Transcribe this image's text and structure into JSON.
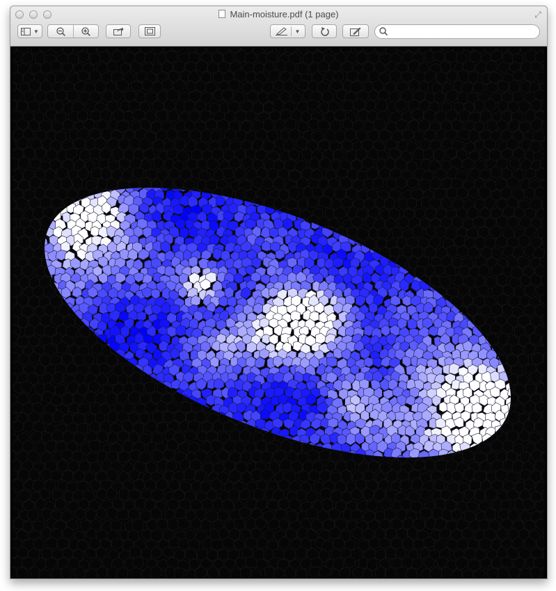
{
  "window": {
    "title": "Main-moisture.pdf (1 page)"
  },
  "toolbar": {
    "sidebar_icon": "sidebar-view-icon",
    "zoom_out_icon": "zoom-out-icon",
    "zoom_in_icon": "zoom-in-icon",
    "share_icon": "share-icon",
    "fit_icon": "fit-to-window-icon",
    "annotate_icon": "annotate-pen-icon",
    "rotate_icon": "rotate-icon",
    "edit_icon": "edit-icon",
    "search_placeholder": "",
    "search_value": ""
  },
  "colors": {
    "window_bg": "#d9d9d9",
    "document_bg": "#050505",
    "high": "#ffffff",
    "low": "#0000ff"
  }
}
